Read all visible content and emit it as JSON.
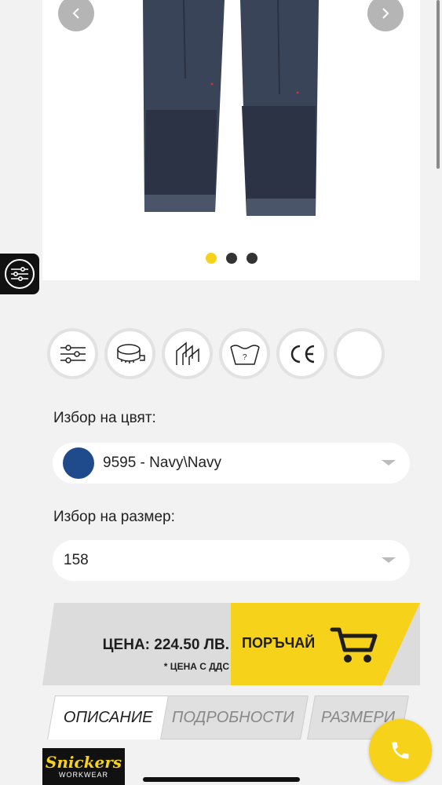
{
  "gallery": {
    "dots_count": 3,
    "active_dot": 1
  },
  "features": [
    "filter-settings-icon",
    "tape-measure-icon",
    "fabric-layers-icon",
    "wash-care-icon",
    "ce-mark-icon",
    "empty-circle"
  ],
  "color_select": {
    "label": "Избор на цвят:",
    "value": "9595 - Navy\\Navy",
    "swatch_color": "#1f4a8b"
  },
  "size_select": {
    "label": "Избор на размер:",
    "value": "158"
  },
  "price": {
    "main": "ЦЕНА: 224.50 ЛВ.",
    "note": "* ЦЕНА С ДДС",
    "order_label": "ПОРЪЧАЙ"
  },
  "tabs": [
    "ОПИСАНИЕ",
    "ПОДРОБНОСТИ",
    "РАЗМЕРИ"
  ],
  "logo": {
    "main": "Snickers",
    "sub": "WORKWEAR"
  },
  "colors": {
    "accent": "#f6d21a",
    "dark": "#111111",
    "navy": "#1f4a8b"
  }
}
